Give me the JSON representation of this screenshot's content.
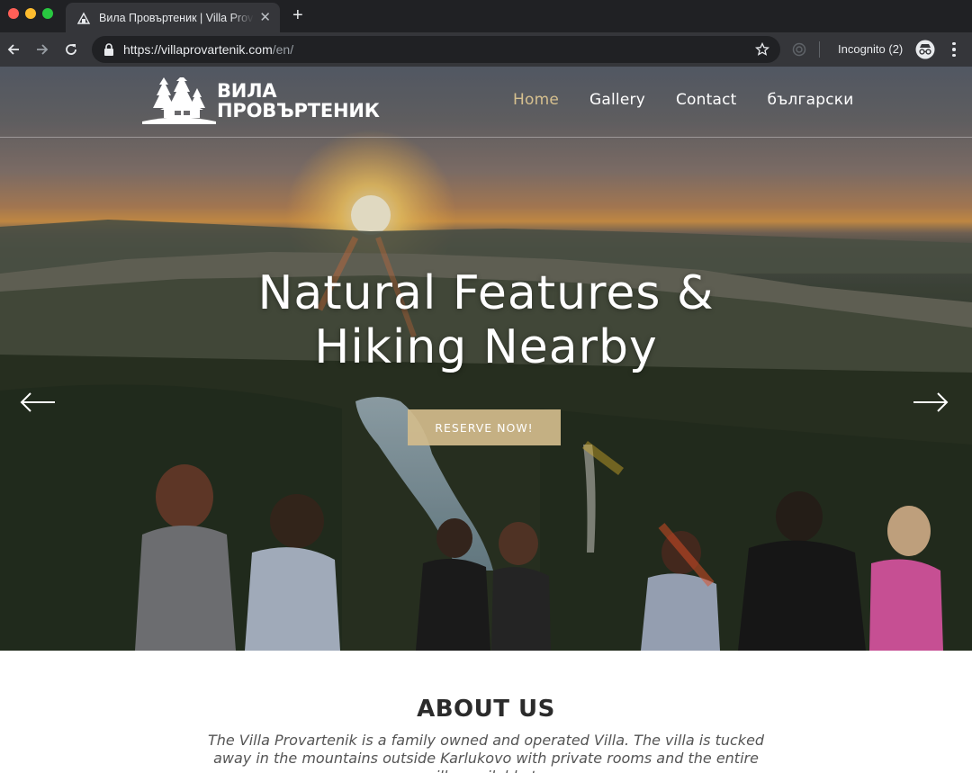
{
  "browser": {
    "tab_title": "Вила Провъртеник | Villa Provartenik",
    "url_host": "https://villaprovartenik.com",
    "url_path": "/en/",
    "incognito_label": "Incognito (2)"
  },
  "site": {
    "logo_line1": "ВИЛА",
    "logo_line2": "ПРОВЪРТЕНИК",
    "nav": {
      "home": "Home",
      "gallery": "Gallery",
      "contact": "Contact",
      "language": "български"
    },
    "hero": {
      "title_line1": "Natural Features &",
      "title_line2": "Hiking Nearby",
      "cta": "RESERVE NOW!"
    },
    "about": {
      "heading": "ABOUT US",
      "text": "The Villa Provartenik is a family owned and operated Villa. The villa is tucked away in the mountains outside Karlukovo with private rooms and the entire villa available to"
    }
  },
  "colors": {
    "nav_active": "#d6c08f",
    "cta_background": "#d2bc8c",
    "chrome_dark": "#202124",
    "chrome_toolbar": "#35363a"
  }
}
